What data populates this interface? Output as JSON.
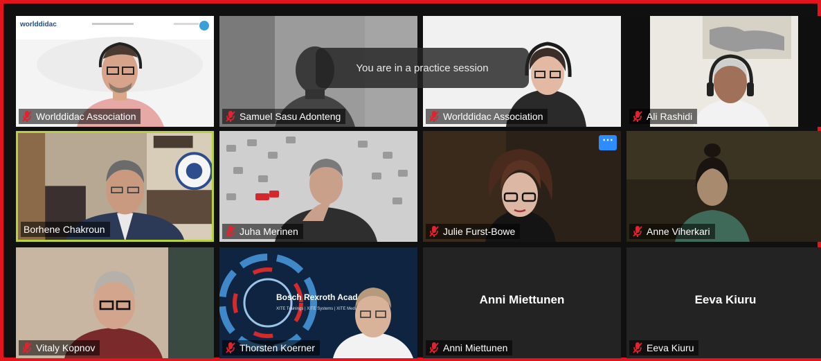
{
  "notice": {
    "text": "You are in a practice session"
  },
  "participants": [
    {
      "name": "Worlddidac Association",
      "video": true,
      "muted": true
    },
    {
      "name": "Samuel Sasu Adonteng",
      "video": true,
      "muted": true
    },
    {
      "name": "Worlddidac Association",
      "video": true,
      "muted": true
    },
    {
      "name": "Ali Rashidi",
      "video": true,
      "muted": true
    },
    {
      "name": "Borhene Chakroun",
      "video": true,
      "muted": false,
      "active_speaker": true
    },
    {
      "name": "Juha Merinen",
      "video": true,
      "muted": true
    },
    {
      "name": "Julie Furst-Bowe",
      "video": true,
      "muted": true
    },
    {
      "name": "Anne Viherkari",
      "video": true,
      "muted": true
    },
    {
      "name": "Vitaly Kopnov",
      "video": true,
      "muted": true
    },
    {
      "name": "Thorsten Koerner",
      "video": true,
      "muted": true
    },
    {
      "name": "Anni Miettunen",
      "video": false,
      "muted": true
    },
    {
      "name": "Eeva Kiuru",
      "video": false,
      "muted": true
    }
  ],
  "slides": {
    "worlddidac_logo": "worlddidac",
    "bosch_title": "Bosch Rexroth Academ",
    "bosch_subtitle": "XITE Trainings | XITE Systems | XITE Medi"
  },
  "icons": {
    "muted_mic": "mic-muted-icon",
    "more_options": "more-options-icon"
  },
  "colors": {
    "frame_border": "#e3141c",
    "active_speaker_border": "#b8d33a",
    "muted_icon": "#e0232e",
    "more_button": "#2d8cff"
  }
}
